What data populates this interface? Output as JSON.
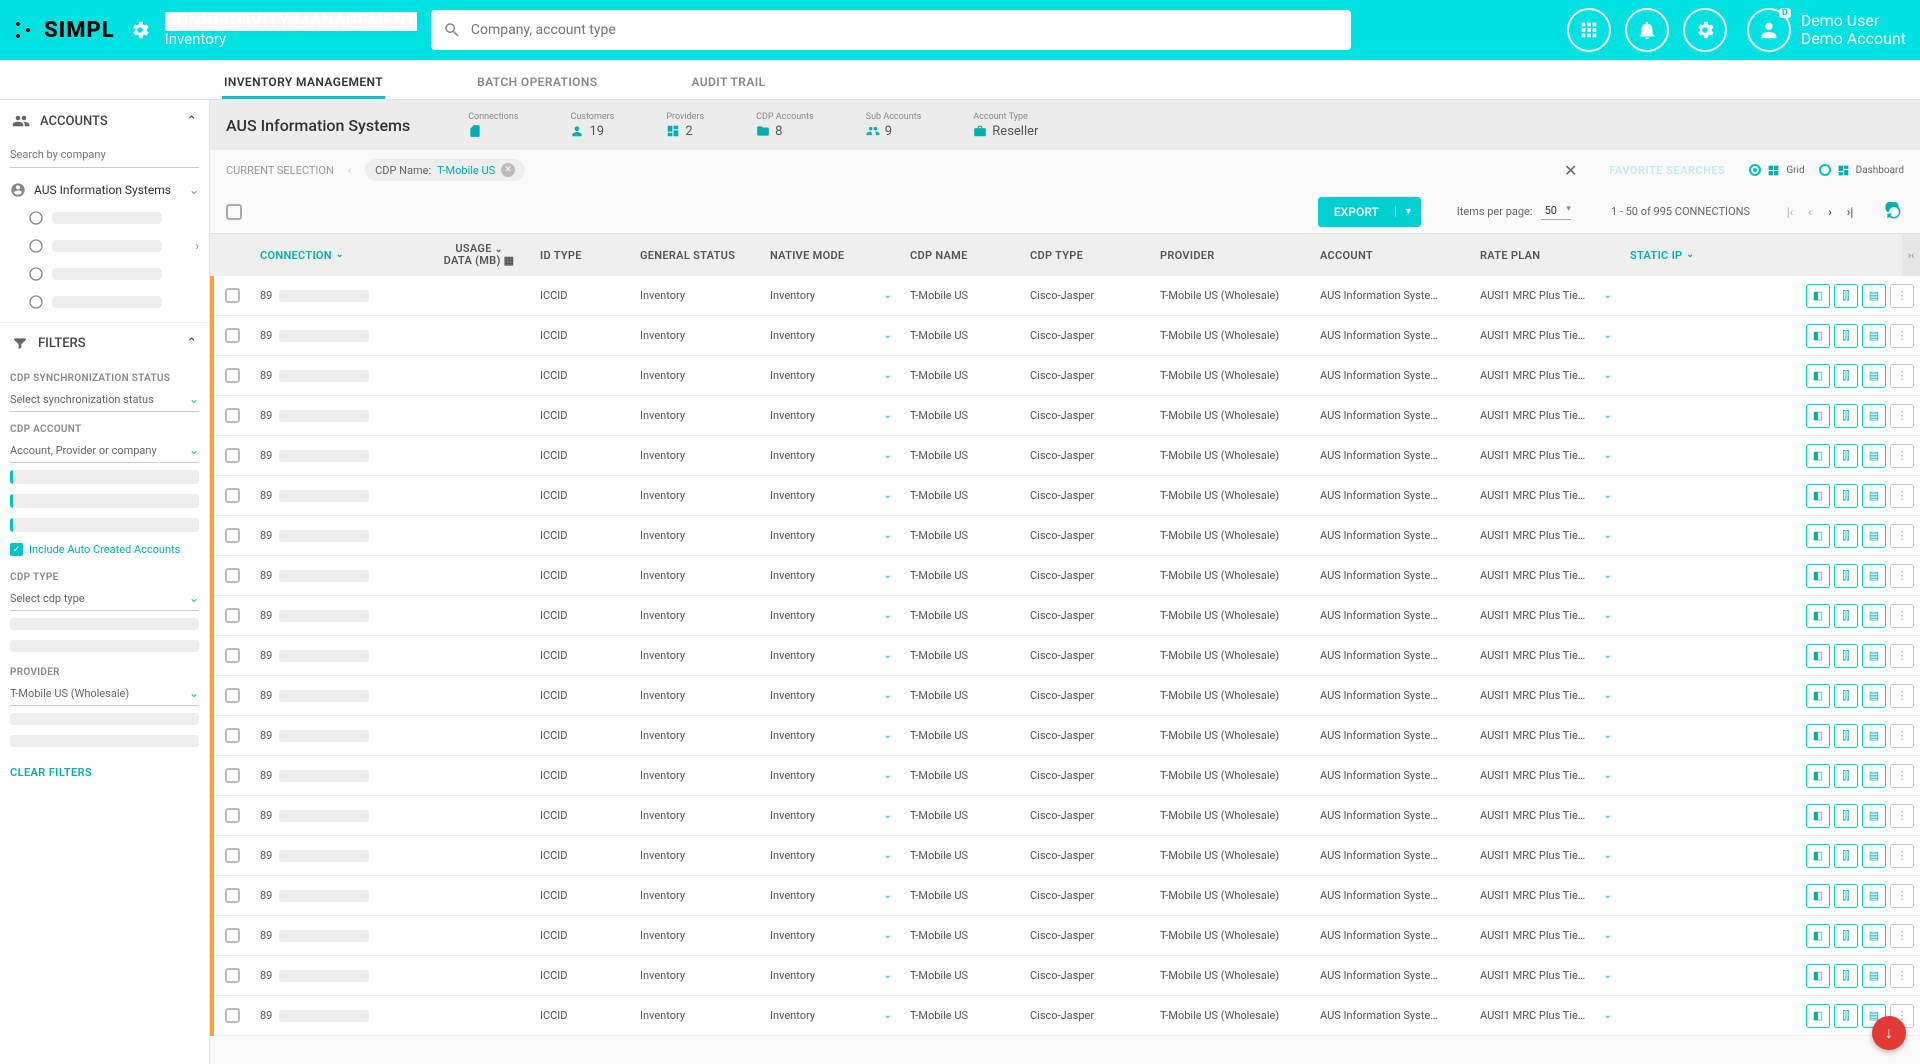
{
  "header": {
    "logo_text": "SIMPL",
    "title": "CONNECTIVITY MANAGEMENT",
    "subtitle": "Inventory",
    "search_placeholder": "Company, account type",
    "user_name": "Demo User",
    "user_account": "Demo Account"
  },
  "tabs": {
    "inventory": "INVENTORY MANAGEMENT",
    "batch": "BATCH OPERATIONS",
    "audit": "AUDIT TRAIL"
  },
  "sidebar": {
    "accounts_label": "ACCOUNTS",
    "search_placeholder": "Search by company",
    "active_account": "AUS Information Systems",
    "filters_label": "FILTERS",
    "sync_status_label": "CDP SYNCHRONIZATION STATUS",
    "sync_status_placeholder": "Select synchronization status",
    "cdp_account_label": "CDP ACCOUNT",
    "cdp_account_placeholder": "Account, Provider or company",
    "include_auto": "Include Auto Created Accounts",
    "cdp_type_label": "CDP TYPE",
    "cdp_type_placeholder": "Select cdp type",
    "provider_label": "PROVIDER",
    "provider_value": "T-Mobile US (Wholesale)",
    "clear_filters": "CLEAR FILTERS"
  },
  "info": {
    "company": "AUS Information Systems",
    "stats": {
      "connections": {
        "label": "Connections",
        "value": ""
      },
      "customers": {
        "label": "Customers",
        "value": "19"
      },
      "providers": {
        "label": "Providers",
        "value": "2"
      },
      "cdp_accounts": {
        "label": "CDP Accounts",
        "value": "8"
      },
      "sub_accounts": {
        "label": "Sub Accounts",
        "value": "9"
      },
      "account_type": {
        "label": "Account Type",
        "value": "Reseller"
      }
    }
  },
  "selection": {
    "label": "CURRENT SELECTION",
    "chip_key": "CDP Name:",
    "chip_value": "T-Mobile US",
    "favorite_searches": "FAVORITE SEARCHES",
    "view_grid": "Grid",
    "view_dashboard": "Dashboard"
  },
  "toolbar": {
    "export": "EXPORT",
    "items_pp_label": "Items per page:",
    "items_pp_value": "50",
    "range": "1 - 50 of 995 CONNECTIONS"
  },
  "columns": {
    "connection": "CONNECTION",
    "usage_l1": "USAGE",
    "usage_l2": "DATA (MB)",
    "id_type": "ID TYPE",
    "general_status": "GENERAL STATUS",
    "native_mode": "NATIVE MODE",
    "cdp_name": "CDP NAME",
    "cdp_type": "CDP TYPE",
    "provider": "PROVIDER",
    "account": "ACCOUNT",
    "rate_plan": "RATE PLAN",
    "static_ip": "STATIC IP"
  },
  "row": {
    "connection_prefix": "89",
    "id_type": "ICCID",
    "general_status": "Inventory",
    "native_mode": "Inventory",
    "cdp_name": "T-Mobile US",
    "cdp_type": "Cisco-Jasper",
    "provider": "T-Mobile US (Wholesale)",
    "account": "AUS Information Syste…",
    "rate_plan": "AUSI1 MRC Plus Tie…"
  },
  "row_count": 19
}
